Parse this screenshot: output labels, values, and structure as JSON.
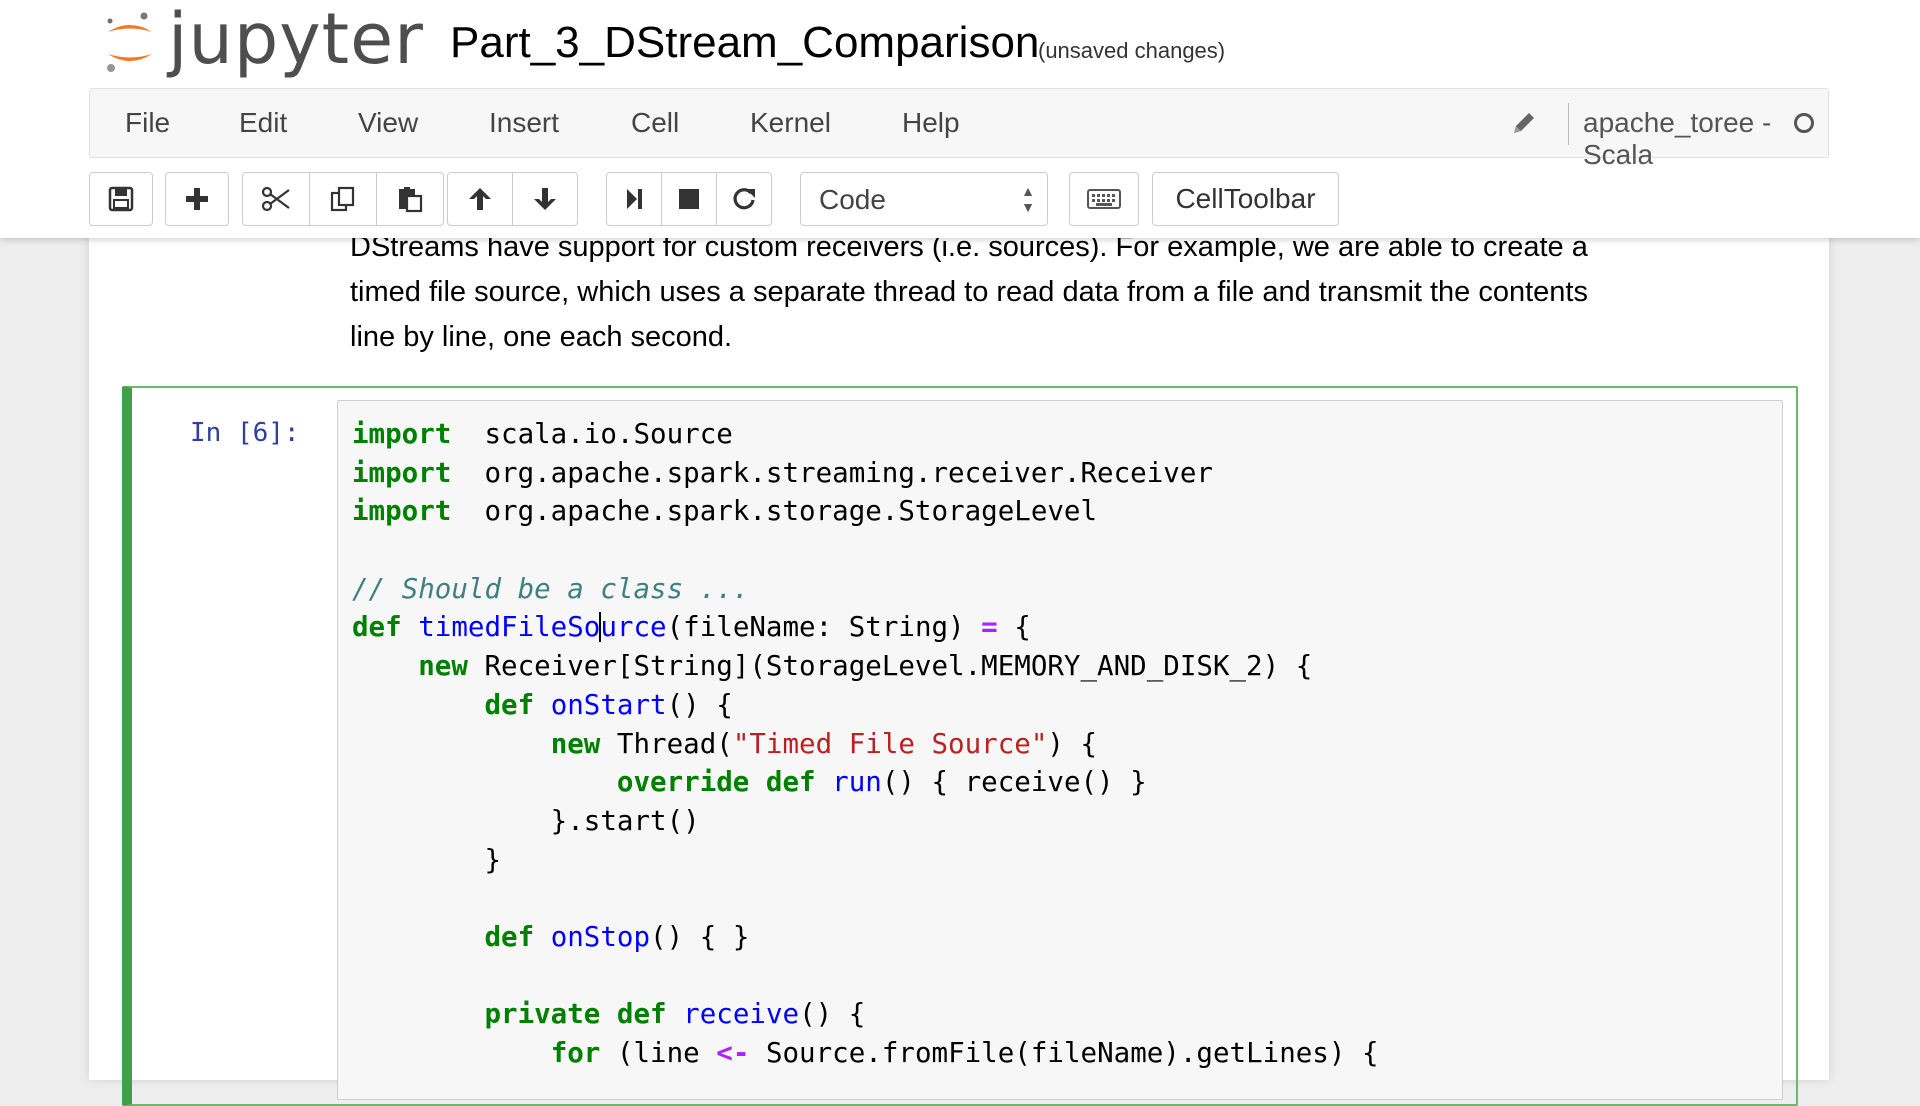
{
  "header": {
    "logo_text": "jupyter",
    "notebook_title": "Part_3_DStream_Comparison",
    "save_status": "(unsaved changes)"
  },
  "menubar": {
    "items": [
      "File",
      "Edit",
      "View",
      "Insert",
      "Cell",
      "Kernel",
      "Help"
    ],
    "kernel_name": "apache_toree - Scala"
  },
  "toolbar": {
    "icons": [
      "save-icon",
      "plus-icon",
      "scissors-icon",
      "copy-icon",
      "paste-icon",
      "arrow-up-icon",
      "arrow-down-icon",
      "run-icon",
      "stop-icon",
      "restart-icon",
      "keyboard-icon"
    ],
    "cell_type": "Code",
    "celltoolbar_label": "CellToolbar"
  },
  "markdown": {
    "lines": [
      "DStreams have support for custom receivers (i.e. sources). For example, we are able to create a",
      "timed file source, which uses a separate thread to read data from a file and transmit the contents",
      "line by line, one each second."
    ]
  },
  "code_cell": {
    "prompt": "In [6]:",
    "lines": [
      [
        [
          "kw",
          "import"
        ],
        [
          "",
          "  scala.io.Source"
        ]
      ],
      [
        [
          "kw",
          "import"
        ],
        [
          "",
          "  org.apache.spark.streaming.receiver.Receiver"
        ]
      ],
      [
        [
          "kw",
          "import"
        ],
        [
          "",
          "  org.apache.spark.storage.StorageLevel"
        ]
      ],
      [],
      [
        [
          "cm",
          "// Should be a class ..."
        ]
      ],
      [
        [
          "kw",
          "def"
        ],
        [
          "",
          " "
        ],
        [
          "fn",
          "timedFileSo"
        ],
        [
          "cursor",
          ""
        ],
        [
          "fn",
          "urce"
        ],
        [
          "",
          "(fileName: String) "
        ],
        [
          "op",
          "="
        ],
        [
          "",
          " {"
        ]
      ],
      [
        [
          "",
          "    "
        ],
        [
          "kw",
          "new"
        ],
        [
          "",
          " Receiver[String](StorageLevel.MEMORY_AND_DISK_2) {"
        ]
      ],
      [
        [
          "",
          "        "
        ],
        [
          "kw",
          "def"
        ],
        [
          "",
          " "
        ],
        [
          "fn",
          "onStart"
        ],
        [
          "",
          "() {"
        ]
      ],
      [
        [
          "",
          "            "
        ],
        [
          "kw",
          "new"
        ],
        [
          "",
          " Thread("
        ],
        [
          "st",
          "\"Timed File Source\""
        ],
        [
          "",
          ") {"
        ]
      ],
      [
        [
          "",
          "                "
        ],
        [
          "kw",
          "override"
        ],
        [
          "",
          " "
        ],
        [
          "kw",
          "def"
        ],
        [
          "",
          " "
        ],
        [
          "fn",
          "run"
        ],
        [
          "",
          "() { receive() }"
        ]
      ],
      [
        [
          "",
          "            }.start()"
        ]
      ],
      [
        [
          "",
          "        }"
        ]
      ],
      [],
      [
        [
          "",
          "        "
        ],
        [
          "kw",
          "def"
        ],
        [
          "",
          " "
        ],
        [
          "fn",
          "onStop"
        ],
        [
          "",
          "() { }"
        ]
      ],
      [],
      [
        [
          "",
          "        "
        ],
        [
          "kw",
          "private"
        ],
        [
          "",
          " "
        ],
        [
          "kw",
          "def"
        ],
        [
          "",
          " "
        ],
        [
          "fn",
          "receive"
        ],
        [
          "",
          "() {"
        ]
      ],
      [
        [
          "",
          "            "
        ],
        [
          "kw",
          "for"
        ],
        [
          "",
          " (line "
        ],
        [
          "op",
          "<-"
        ],
        [
          "",
          " Source.fromFile(fileName).getLines) {"
        ]
      ]
    ]
  }
}
